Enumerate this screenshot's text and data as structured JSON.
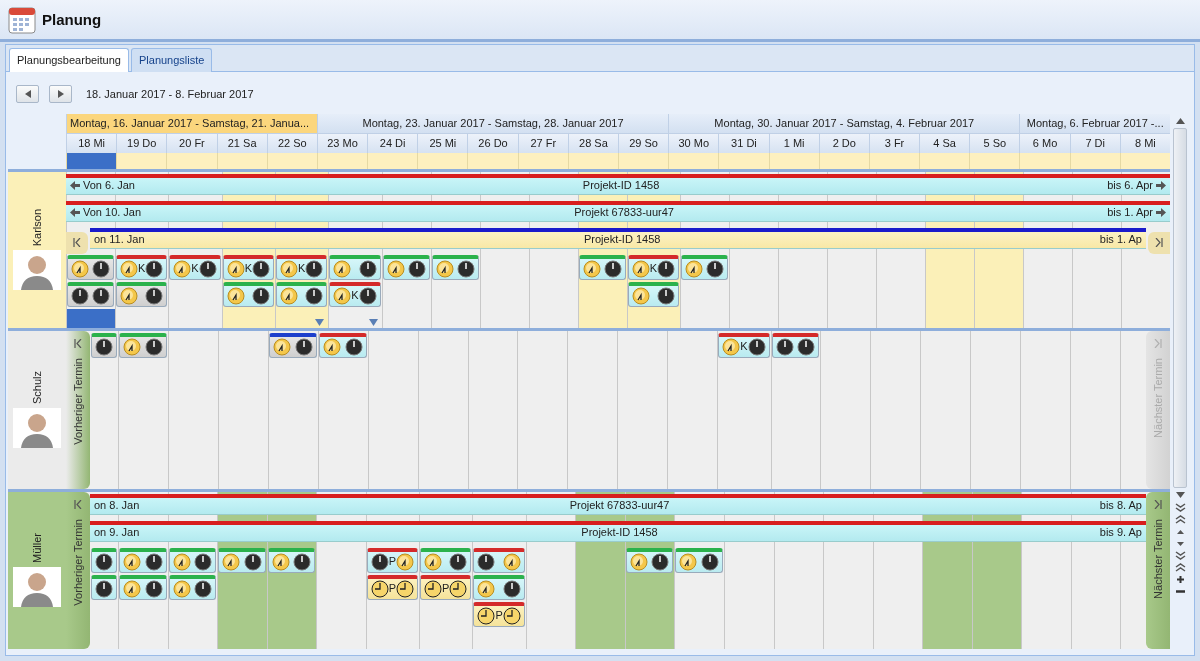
{
  "window": {
    "title": "Planung"
  },
  "tabs": [
    {
      "label": "Planungsbearbeitung",
      "selected": true
    },
    {
      "label": "Planungsliste",
      "selected": false
    }
  ],
  "range": "18. Januar 2017 - 8. Februar 2017",
  "weeks": [
    {
      "label": "Montag, 16. Januar 2017 - Samstag, 21. Janua...",
      "selected": true,
      "days": [
        {
          "label": "18 Mi",
          "weekend": false,
          "selected": true
        },
        {
          "label": "19 Do",
          "weekend": false,
          "selected": false
        },
        {
          "label": "20 Fr",
          "weekend": false,
          "selected": false
        },
        {
          "label": "21 Sa",
          "weekend": true,
          "selected": false
        },
        {
          "label": "22 So",
          "weekend": true,
          "selected": false
        }
      ]
    },
    {
      "label": "Montag, 23. Januar 2017 - Samstag, 28. Januar 2017",
      "selected": false,
      "days": [
        {
          "label": "23 Mo",
          "weekend": false,
          "selected": false
        },
        {
          "label": "24 Di",
          "weekend": false,
          "selected": false
        },
        {
          "label": "25 Mi",
          "weekend": false,
          "selected": false
        },
        {
          "label": "26 Do",
          "weekend": false,
          "selected": false
        },
        {
          "label": "27 Fr",
          "weekend": false,
          "selected": false
        },
        {
          "label": "28 Sa",
          "weekend": true,
          "selected": false
        },
        {
          "label": "29 So",
          "weekend": true,
          "selected": false
        }
      ]
    },
    {
      "label": "Montag, 30. Januar 2017 - Samstag, 4. Februar 2017",
      "selected": false,
      "days": [
        {
          "label": "30 Mo",
          "weekend": false,
          "selected": false
        },
        {
          "label": "31 Di",
          "weekend": false,
          "selected": false
        },
        {
          "label": "1 Mi",
          "weekend": false,
          "selected": false
        },
        {
          "label": "2 Do",
          "weekend": false,
          "selected": false
        },
        {
          "label": "3 Fr",
          "weekend": false,
          "selected": false
        },
        {
          "label": "4 Sa",
          "weekend": true,
          "selected": false
        },
        {
          "label": "5 So",
          "weekend": true,
          "selected": false
        }
      ]
    },
    {
      "label": "Montag, 6. Februar 2017 -...",
      "selected": false,
      "days": [
        {
          "label": "6 Mo",
          "weekend": false,
          "selected": false
        },
        {
          "label": "7 Di",
          "weekend": false,
          "selected": false
        },
        {
          "label": "8 Mi",
          "weekend": false,
          "selected": false
        }
      ]
    }
  ],
  "resources": [
    {
      "name": "Karlson",
      "color": "#fbf0b8",
      "highlight_weekends": true,
      "prev_tab": {
        "disabled": false
      },
      "next_tab": {
        "disabled": false
      },
      "bars": [
        {
          "color": "#d81e1e",
          "kind": "project",
          "arrows": true,
          "start": "Von 6. Jan",
          "title": "Projekt-ID 1458",
          "end": "bis 6. Apr"
        },
        {
          "color": "#d81e1e",
          "kind": "project",
          "arrows": true,
          "start": "Von 10. Jan",
          "title": "Projekt 67833-uur47",
          "end": "bis 1. Apr"
        },
        {
          "color": "#1a1acb",
          "kind": "planned",
          "arrows": false,
          "start": "on 11. Jan",
          "title": "Projekt-ID 1458",
          "end": "bis 1. Ap"
        }
      ],
      "cells": [
        {
          "selected": true,
          "tiles": [
            {
              "color": "#2bb24c",
              "kind": "inactive",
              "icons": [
                {
                  "kind": "dial"
                },
                {
                  "kind": "clock"
                }
              ]
            },
            {
              "color": "#2bb24c",
              "kind": "inactive",
              "icons": [
                {
                  "kind": "clock"
                },
                {
                  "kind": "clock"
                }
              ]
            }
          ]
        },
        {
          "selected": false,
          "tiles": [
            {
              "color": "#d42a2a",
              "kind": "normal",
              "icons": [
                {
                  "kind": "dial"
                },
                {
                  "kind": "clock"
                }
              ],
              "letter": "K"
            },
            {
              "color": "#2bb24c",
              "kind": "inactive",
              "icons": [
                {
                  "kind": "dial"
                },
                {
                  "kind": "clock"
                }
              ]
            }
          ]
        },
        {
          "selected": false,
          "tiles": [
            {
              "color": "#d42a2a",
              "kind": "normal",
              "icons": [
                {
                  "kind": "dial"
                },
                {
                  "kind": "clock"
                }
              ],
              "letter": "K"
            }
          ]
        },
        {
          "selected": false,
          "tiles": [
            {
              "color": "#d42a2a",
              "kind": "normal",
              "icons": [
                {
                  "kind": "dial"
                },
                {
                  "kind": "clock"
                }
              ],
              "letter": "K"
            },
            {
              "color": "#2bb24c",
              "kind": "normal",
              "icons": [
                {
                  "kind": "dial"
                },
                {
                  "kind": "clock"
                }
              ]
            }
          ]
        },
        {
          "selected": false,
          "more": true,
          "tiles": [
            {
              "color": "#d42a2a",
              "kind": "normal",
              "icons": [
                {
                  "kind": "dial"
                },
                {
                  "kind": "clock"
                }
              ],
              "letter": "K"
            },
            {
              "color": "#2bb24c",
              "kind": "normal",
              "icons": [
                {
                  "kind": "dial"
                },
                {
                  "kind": "clock"
                }
              ]
            }
          ]
        },
        {
          "selected": false,
          "more": true,
          "tiles": [
            {
              "color": "#2bb24c",
              "kind": "normal",
              "icons": [
                {
                  "kind": "dial"
                },
                {
                  "kind": "clock"
                }
              ]
            },
            {
              "color": "#d42a2a",
              "kind": "normal",
              "icons": [
                {
                  "kind": "dial"
                },
                {
                  "kind": "clock"
                }
              ],
              "letter": "K"
            }
          ]
        },
        {
          "selected": false,
          "tiles": [
            {
              "color": "#2bb24c",
              "kind": "normal",
              "icons": [
                {
                  "kind": "dial"
                },
                {
                  "kind": "clock"
                }
              ]
            }
          ]
        },
        {
          "selected": false,
          "tiles": [
            {
              "color": "#2bb24c",
              "kind": "normal",
              "icons": [
                {
                  "kind": "dial"
                },
                {
                  "kind": "clock"
                }
              ]
            }
          ]
        },
        {
          "selected": false
        },
        {
          "selected": false
        },
        {
          "selected": false,
          "tiles": [
            {
              "color": "#2bb24c",
              "kind": "normal",
              "icons": [
                {
                  "kind": "dial"
                },
                {
                  "kind": "clock"
                }
              ]
            }
          ]
        },
        {
          "selected": false,
          "tiles": [
            {
              "color": "#d42a2a",
              "kind": "normal",
              "icons": [
                {
                  "kind": "dial"
                },
                {
                  "kind": "clock"
                }
              ],
              "letter": "K"
            },
            {
              "color": "#2bb24c",
              "kind": "normal",
              "icons": [
                {
                  "kind": "dial"
                },
                {
                  "kind": "clock"
                }
              ]
            }
          ]
        },
        {
          "selected": false,
          "tiles": [
            {
              "color": "#2bb24c",
              "kind": "normal",
              "icons": [
                {
                  "kind": "dial"
                },
                {
                  "kind": "clock"
                }
              ]
            }
          ]
        },
        {
          "selected": false
        },
        {
          "selected": false
        },
        {
          "selected": false
        },
        {
          "selected": false
        },
        {
          "selected": false
        },
        {
          "selected": false
        },
        {
          "selected": false
        },
        {
          "selected": false
        },
        {
          "selected": false
        }
      ]
    },
    {
      "name": "Schulz",
      "color": "#ebebeb",
      "highlight_weekends": false,
      "prev_tab": {
        "label": "Vorheriger Termin",
        "disabled": false
      },
      "next_tab": {
        "label": "Nächster Termin",
        "disabled": true
      },
      "cells": [
        {
          "selected": false,
          "tiles": [
            {
              "color": "#2bb24c",
              "kind": "inactive",
              "icons": [
                {
                  "kind": "clock"
                }
              ]
            }
          ]
        },
        {
          "selected": false,
          "tiles": [
            {
              "color": "#2bb24c",
              "kind": "inactive",
              "icons": [
                {
                  "kind": "dial"
                },
                {
                  "kind": "clock"
                }
              ]
            }
          ]
        },
        {
          "selected": false
        },
        {
          "selected": false
        },
        {
          "selected": false,
          "tiles": [
            {
              "color": "#1d3fcc",
              "kind": "inactive",
              "icons": [
                {
                  "kind": "dial"
                },
                {
                  "kind": "clock"
                }
              ]
            }
          ]
        },
        {
          "selected": false,
          "tiles": [
            {
              "color": "#d42a2a",
              "kind": "normal",
              "icons": [
                {
                  "kind": "dial"
                },
                {
                  "kind": "clock"
                }
              ]
            }
          ]
        },
        {
          "selected": false
        },
        {
          "selected": false
        },
        {
          "selected": false
        },
        {
          "selected": false
        },
        {
          "selected": false
        },
        {
          "selected": false
        },
        {
          "selected": false
        },
        {
          "selected": false,
          "tiles": [
            {
              "color": "#d42a2a",
              "kind": "normal",
              "icons": [
                {
                  "kind": "dial"
                },
                {
                  "kind": "clock"
                }
              ],
              "letter": "K"
            }
          ]
        },
        {
          "selected": false,
          "tiles": [
            {
              "color": "#d42a2a",
              "kind": "normal",
              "icons": [
                {
                  "kind": "clock"
                },
                {
                  "kind": "clock"
                }
              ]
            }
          ]
        },
        {
          "selected": false
        },
        {
          "selected": false
        },
        {
          "selected": false
        },
        {
          "selected": false
        },
        {
          "selected": false
        },
        {
          "selected": false
        },
        {
          "selected": false
        }
      ]
    },
    {
      "name": "Müller",
      "color": "#a8c98a",
      "highlight_weekends": true,
      "prev_tab": {
        "label": "Vorheriger Termin",
        "disabled": false
      },
      "next_tab": {
        "label": "Nächster Termin",
        "disabled": false
      },
      "bars": [
        {
          "color": "#d81e1e",
          "kind": "project",
          "arrows": false,
          "start": "on 8. Jan",
          "title": "Projekt 67833-uur47",
          "end": "bis 8. Ap"
        },
        {
          "color": "#d81e1e",
          "kind": "project",
          "arrows": false,
          "start": "on 9. Jan",
          "title": "Projekt-ID 1458",
          "end": "bis 9. Ap"
        }
      ],
      "cells": [
        {
          "selected": false,
          "tiles": [
            {
              "color": "#2bb24c",
              "kind": "normal",
              "icons": [
                {
                  "kind": "clock"
                }
              ]
            },
            {
              "color": "#2bb24c",
              "kind": "normal",
              "icons": [
                {
                  "kind": "clock"
                }
              ]
            }
          ]
        },
        {
          "selected": false,
          "tiles": [
            {
              "color": "#2bb24c",
              "kind": "normal",
              "icons": [
                {
                  "kind": "dial"
                },
                {
                  "kind": "clock"
                }
              ]
            },
            {
              "color": "#2bb24c",
              "kind": "normal",
              "icons": [
                {
                  "kind": "dial"
                },
                {
                  "kind": "clock"
                }
              ]
            }
          ]
        },
        {
          "selected": false,
          "tiles": [
            {
              "color": "#2bb24c",
              "kind": "normal",
              "icons": [
                {
                  "kind": "dial"
                },
                {
                  "kind": "clock"
                }
              ]
            },
            {
              "color": "#2bb24c",
              "kind": "normal",
              "icons": [
                {
                  "kind": "dial"
                },
                {
                  "kind": "clock"
                }
              ]
            }
          ]
        },
        {
          "selected": false,
          "tiles": [
            {
              "color": "#2bb24c",
              "kind": "normal",
              "icons": [
                {
                  "kind": "dial"
                },
                {
                  "kind": "clock"
                }
              ]
            }
          ]
        },
        {
          "selected": false,
          "tiles": [
            {
              "color": "#2bb24c",
              "kind": "normal",
              "icons": [
                {
                  "kind": "dial"
                },
                {
                  "kind": "clock"
                }
              ]
            }
          ]
        },
        {
          "selected": false
        },
        {
          "selected": false,
          "tiles": [
            {
              "color": "#d42a2a",
              "kind": "normal",
              "icons": [
                {
                  "kind": "clock"
                },
                {
                  "kind": "dial"
                }
              ],
              "letter": "P"
            },
            {
              "color": "#d42a2a",
              "kind": "pause",
              "icons": [
                {
                  "kind": "face"
                },
                {
                  "kind": "face"
                }
              ],
              "letter": "P"
            }
          ]
        },
        {
          "selected": false,
          "tiles": [
            {
              "color": "#2bb24c",
              "kind": "normal",
              "icons": [
                {
                  "kind": "dial"
                },
                {
                  "kind": "clock"
                }
              ]
            },
            {
              "color": "#d42a2a",
              "kind": "pause",
              "icons": [
                {
                  "kind": "face"
                },
                {
                  "kind": "face"
                }
              ],
              "letter": "P"
            }
          ]
        },
        {
          "selected": false,
          "tiles": [
            {
              "color": "#d42a2a",
              "kind": "normal",
              "icons": [
                {
                  "kind": "clock"
                },
                {
                  "kind": "dial"
                }
              ]
            },
            {
              "color": "#2bb24c",
              "kind": "normal",
              "icons": [
                {
                  "kind": "dial"
                },
                {
                  "kind": "clock"
                }
              ]
            },
            {
              "color": "#d42a2a",
              "kind": "pause",
              "icons": [
                {
                  "kind": "face"
                },
                {
                  "kind": "face"
                }
              ],
              "letter": "P"
            }
          ]
        },
        {
          "selected": false
        },
        {
          "selected": false
        },
        {
          "selected": false,
          "tiles": [
            {
              "color": "#2bb24c",
              "kind": "normal",
              "icons": [
                {
                  "kind": "dial"
                },
                {
                  "kind": "clock"
                }
              ]
            }
          ]
        },
        {
          "selected": false,
          "tiles": [
            {
              "color": "#2bb24c",
              "kind": "normal",
              "icons": [
                {
                  "kind": "dial"
                },
                {
                  "kind": "clock"
                }
              ]
            }
          ]
        },
        {
          "selected": false
        },
        {
          "selected": false
        },
        {
          "selected": false
        },
        {
          "selected": false
        },
        {
          "selected": false
        },
        {
          "selected": false
        },
        {
          "selected": false
        },
        {
          "selected": false
        },
        {
          "selected": false
        }
      ]
    }
  ]
}
